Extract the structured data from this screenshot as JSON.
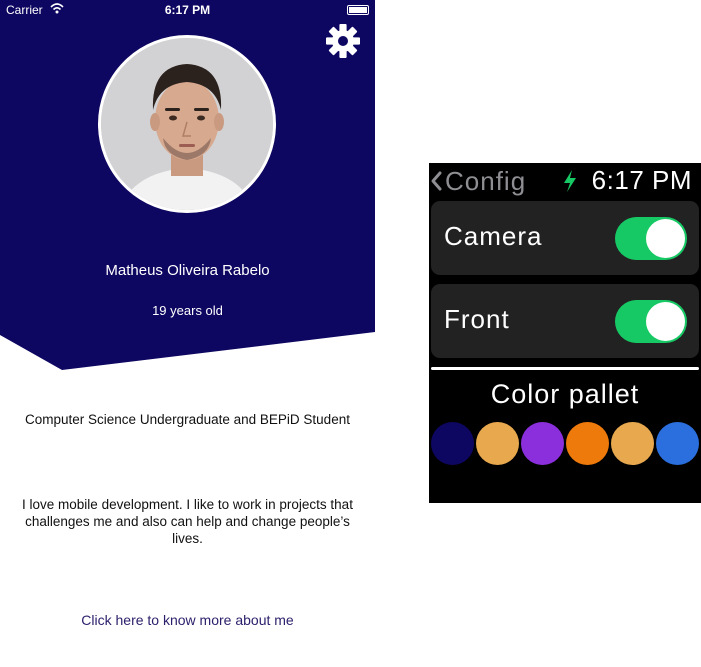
{
  "phone": {
    "status": {
      "carrier": "Carrier",
      "time": "6:17 PM"
    },
    "header_color": "#0e0761",
    "profile": {
      "name": "Matheus Oliveira Rabelo",
      "age": "19 years old",
      "headline": "Computer Science Undergraduate and BEPiD Student",
      "bio": "I love mobile development. I like to work in projects that challenges me and also can help and change people’s lives.",
      "more_link": "Click here to know more about me"
    },
    "settings_icon": "gear-icon"
  },
  "watch": {
    "back_label": "Config",
    "time": "6:17 PM",
    "charging_icon": "bolt-icon",
    "toggles": [
      {
        "label": "Camera",
        "on": true
      },
      {
        "label": "Front",
        "on": true
      }
    ],
    "toggle_color": "#17c964",
    "palette_title": "Color pallet",
    "palette": [
      "#0e0761",
      "#e8a84e",
      "#8b2fdc",
      "#ef7a0c",
      "#e8a84e",
      "#2a6fdd"
    ]
  }
}
